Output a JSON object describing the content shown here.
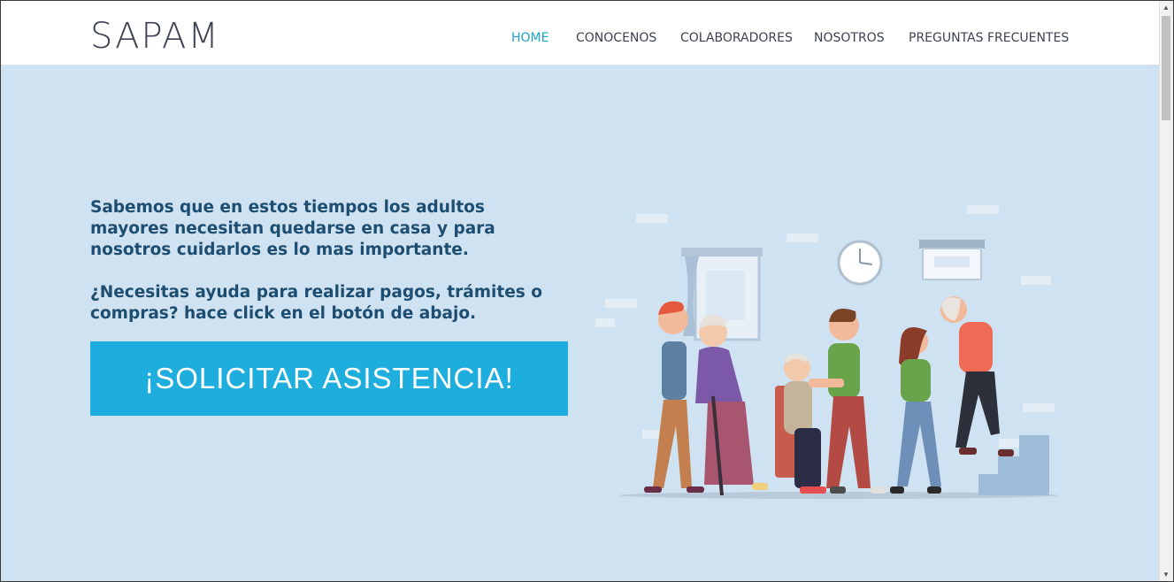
{
  "header": {
    "brand": "SAPAM",
    "nav": [
      {
        "label": "HOME",
        "active": true
      },
      {
        "label": "CONOCENOS",
        "active": false
      },
      {
        "label": "COLABORADORES",
        "active": false
      },
      {
        "label": "NOSOTROS",
        "active": false
      },
      {
        "label": "PREGUNTAS FRECUENTES",
        "active": false
      }
    ]
  },
  "hero": {
    "paragraph_1": "Sabemos que en estos tiempos los adultos mayores necesitan quedarse en casa y para nosotros cuidarlos es lo mas importante.",
    "paragraph_2": "¿Necesitas ayuda para realizar pagos, trámites o compras? hace click en el botón de abajo.",
    "cta_label": "¡SOLICITAR ASISTENCIA!"
  },
  "colors": {
    "accent": "#1ea3c9",
    "button": "#1eaede",
    "background": "#cfe2f1",
    "heading_text": "#1d4d70"
  },
  "icons": {
    "illustration": "family-caregivers-illustration",
    "clock": "clock-icon"
  }
}
